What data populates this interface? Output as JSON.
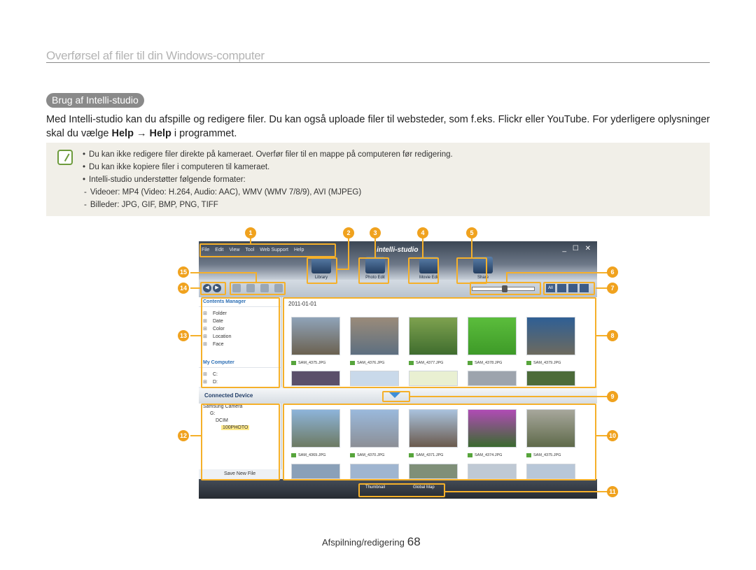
{
  "header": {
    "section_title": "Overførsel af filer til din Windows-computer"
  },
  "badge": "Brug af Intelli-studio",
  "intro": {
    "text_1": "Med Intelli-studio kan du afspille og redigere filer. Du kan også uploade filer til websteder, som f.eks. Flickr eller YouTube. For yderligere oplysninger skal du vælge ",
    "help_1": "Help",
    "arrow": " → ",
    "help_2": "Help",
    "text_2": " i programmet."
  },
  "note": {
    "items": [
      "Du kan ikke redigere filer direkte på kameraet. Overfør filer til en mappe på computeren før redigering.",
      "Du kan ikke kopiere filer i computeren til kameraet.",
      "Intelli-studio understøtter følgende formater:",
      "Videoer: MP4 (Video: H.264, Audio: AAC), WMV (WMV 7/8/9), AVI (MJPEG)",
      "Billeder: JPG, GIF, BMP, PNG, TIFF"
    ]
  },
  "app": {
    "menu": [
      "File",
      "Edit",
      "View",
      "Tool",
      "Web Support",
      "Help"
    ],
    "logo": "intelli-studio",
    "window_controls": "_ ☐ ✕",
    "modules": [
      "Library",
      "Photo Edit",
      "Movie Edit",
      "Share"
    ],
    "filters": [
      "All"
    ],
    "contents_manager": "Contents Manager",
    "tree": [
      "Folder",
      "Date",
      "Color",
      "Location",
      "Face"
    ],
    "my_computer": "My Computer",
    "drives": [
      "C:",
      "D:"
    ],
    "date": "2011-01-01",
    "files_top": [
      "SAM_4375.JPG",
      "SAM_4376.JPG",
      "SAM_4377.JPG",
      "SAM_4378.JPG",
      "SAM_4379.JPG"
    ],
    "connected_device": "Connected Device",
    "device_tree": [
      "Samsung Camera",
      "G:",
      "DCIM",
      "100PHOTO"
    ],
    "save_new_file": "Save New File",
    "files_bottom": [
      "SAM_4369.JPG",
      "SAM_4370.JPG",
      "SAM_4371.JPG",
      "SAM_4374.JPG",
      "SAM_4375.JPG"
    ],
    "view_thumbnail": "Thumbnail",
    "view_global_map": "Global Map"
  },
  "callouts": [
    "1",
    "2",
    "3",
    "4",
    "5",
    "6",
    "7",
    "8",
    "9",
    "10",
    "11",
    "12",
    "13",
    "14",
    "15"
  ],
  "footer": {
    "label": "Afspilning/redigering",
    "page": "68"
  },
  "colors": {
    "callout": "#f0a21e",
    "badge": "#8a8a8a",
    "note_bg": "#f1efe8"
  }
}
